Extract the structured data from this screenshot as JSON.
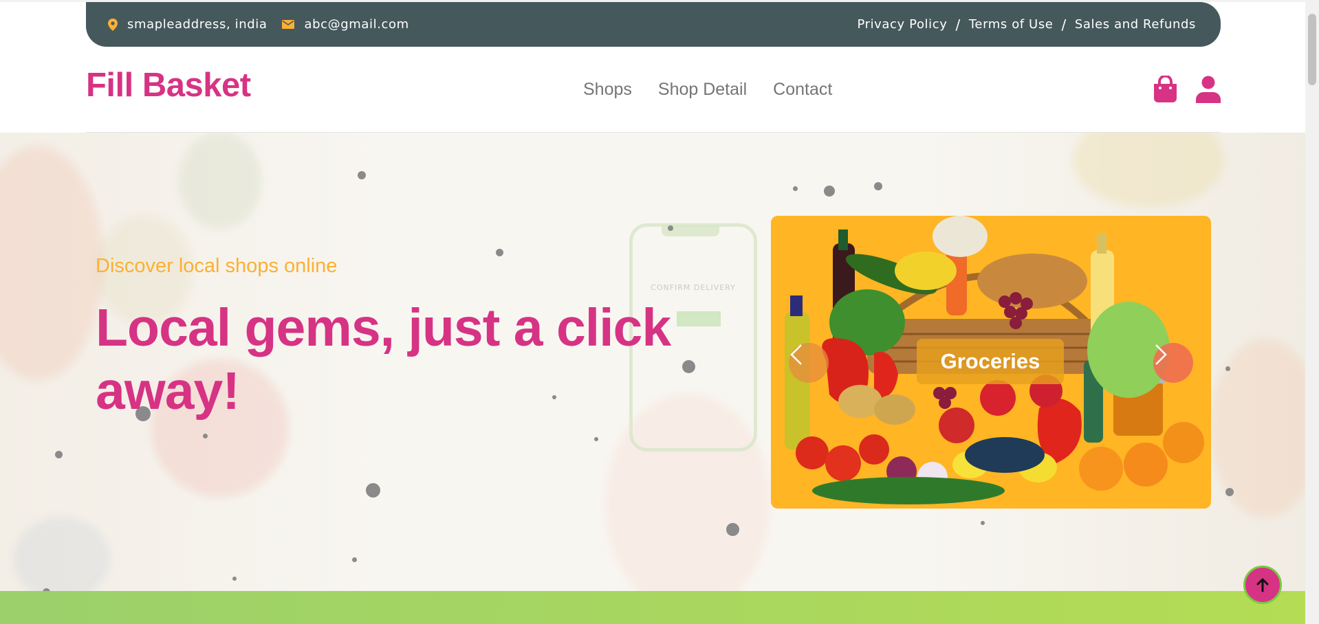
{
  "topbar": {
    "address": "smapleaddress, india",
    "email": "abc@gmail.com",
    "links": [
      "Privacy Policy",
      "Terms of Use",
      "Sales and Refunds"
    ],
    "separator": "/"
  },
  "brand": "Fill Basket",
  "nav": [
    "Shops",
    "Shop Detail",
    "Contact"
  ],
  "hero": {
    "tagline": "Discover local shops online",
    "headline": "Local gems, just a click away!",
    "phone_text": "CONFIRM DELIVERY"
  },
  "carousel": {
    "caption": "Groceries"
  },
  "colors": {
    "brand": "#d63384",
    "accent": "#fbb034",
    "topbar_bg": "#45585c",
    "carousel_bg": "#ffb524",
    "band": "#a9d65f"
  },
  "icons": {
    "address": "map-marker-icon",
    "email": "envelope-icon",
    "cart": "shopping-bag-icon",
    "user": "user-icon",
    "prev": "chevron-left-icon",
    "next": "chevron-right-icon",
    "back_to_top": "arrow-up-icon"
  }
}
